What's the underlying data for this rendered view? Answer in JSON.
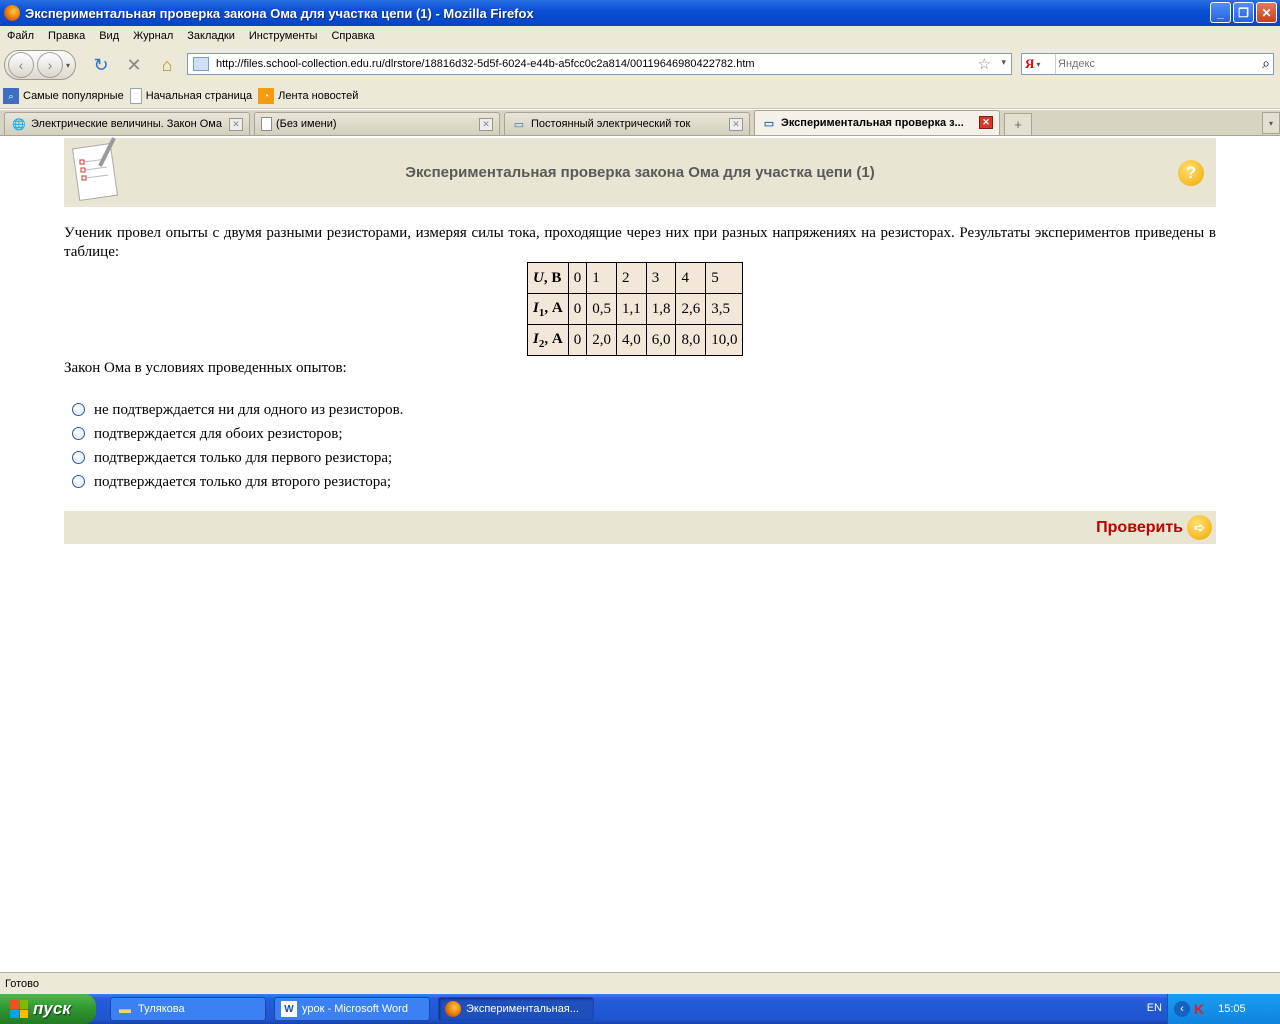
{
  "window": {
    "title": "Экспериментальная проверка закона Ома для участка цепи (1) - Mozilla Firefox",
    "minimize": "_",
    "maximize": "❐",
    "close": "✕"
  },
  "menu": [
    "Файл",
    "Правка",
    "Вид",
    "Журнал",
    "Закладки",
    "Инструменты",
    "Справка"
  ],
  "nav": {
    "url": "http://files.school-collection.edu.ru/dlrstore/18816d32-5d5f-6024-e44b-a5fcc0c2a814/00119646980422782.htm",
    "search_placeholder": "Яндекс",
    "search_engine": "Я"
  },
  "bookmarks": [
    "Самые популярные",
    "Начальная страница",
    "Лента новостей"
  ],
  "tabs": [
    {
      "label": "Электрические величины. Закон Ома",
      "active": false
    },
    {
      "label": "(Без имени)",
      "active": false
    },
    {
      "label": "Постоянный электрический ток",
      "active": false
    },
    {
      "label": "Экспериментальная проверка з...",
      "active": true
    }
  ],
  "page": {
    "header_title": "Экспериментальная проверка закона Ома для участка цепи (1)",
    "help": "?",
    "question": "Ученик провел опыты с двумя разными резисторами, измеряя силы тока, проходящие через них при разных напряжениях на резисторах. Результаты экспериментов приведены в таблице:",
    "table": {
      "rows": [
        {
          "var": "U",
          "sub": "",
          "unit": ", В",
          "values": [
            "0",
            "1",
            "2",
            "3",
            "4",
            "5"
          ]
        },
        {
          "var": "I",
          "sub": "1",
          "unit": ", А",
          "values": [
            "0",
            "0,5",
            "1,1",
            "1,8",
            "2,6",
            "3,5"
          ]
        },
        {
          "var": "I",
          "sub": "2",
          "unit": ", А",
          "values": [
            "0",
            "2,0",
            "4,0",
            "6,0",
            "8,0",
            "10,0"
          ]
        }
      ]
    },
    "law_prompt": "Закон Ома в условиях проведенных опытов:",
    "options": [
      "не подтверждается ни для одного из резисторов.",
      "подтверждается для обоих резисторов;",
      "подтверждается только для первого резистора;",
      "подтверждается только для второго резистора;"
    ],
    "check_label": "Проверить"
  },
  "status": "Готово",
  "taskbar": {
    "start": "пуск",
    "tasks": [
      {
        "label": "Тулякова",
        "icon": "folder-icon"
      },
      {
        "label": "урок - Microsoft Word",
        "icon": "word-icon"
      },
      {
        "label": "Экспериментальная...",
        "icon": "firefox-icon"
      }
    ],
    "lang": "EN",
    "clock": "15:05"
  }
}
